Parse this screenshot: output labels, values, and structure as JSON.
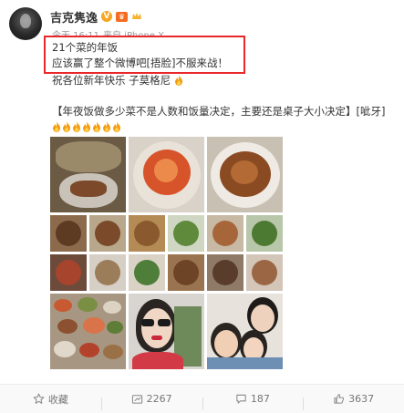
{
  "post": {
    "user_name": "吉克隽逸",
    "verified_mark": "V",
    "vip_mark": "♛",
    "time": "今天 16:11",
    "source": "来自 iPhone X",
    "line1": "21个菜的年饭",
    "line2": "应该赢了整个微博吧[捂脸]不服来战！",
    "line3": "祝各位新年快乐 子莫格尼",
    "line4": "【年夜饭做多少菜不是人数和饭量决定，主要还是桌子大小决定】[呲牙]",
    "fire_counts": {
      "line3": 1,
      "line4": 7
    }
  },
  "photos": [
    {
      "name": "photo-grilled-fish",
      "desc": "fish dish"
    },
    {
      "name": "photo-shrimp-dish",
      "desc": "shrimp"
    },
    {
      "name": "photo-braised-meat",
      "desc": "braised pork"
    },
    {
      "name": "photo-dish-collage-1",
      "desc": "dishes collage"
    },
    {
      "name": "photo-dish-collage-2",
      "desc": "dishes collage"
    },
    {
      "name": "photo-dish-collage-3",
      "desc": "dishes collage"
    },
    {
      "name": "photo-dinner-table",
      "desc": "full table"
    },
    {
      "name": "photo-selfie-woman",
      "desc": "selfie"
    },
    {
      "name": "photo-family-kids",
      "desc": "family"
    }
  ],
  "footer": {
    "favorite_label": "收藏",
    "repost_count": "2267",
    "comment_count": "187",
    "like_count": "3637"
  },
  "colors": {
    "highlight_border": "#e8282b",
    "name_text": "#333333",
    "meta_text": "#9a9a9a",
    "fire": "#f39c12",
    "verified": "#f6a623",
    "vip": "#f36c21"
  }
}
